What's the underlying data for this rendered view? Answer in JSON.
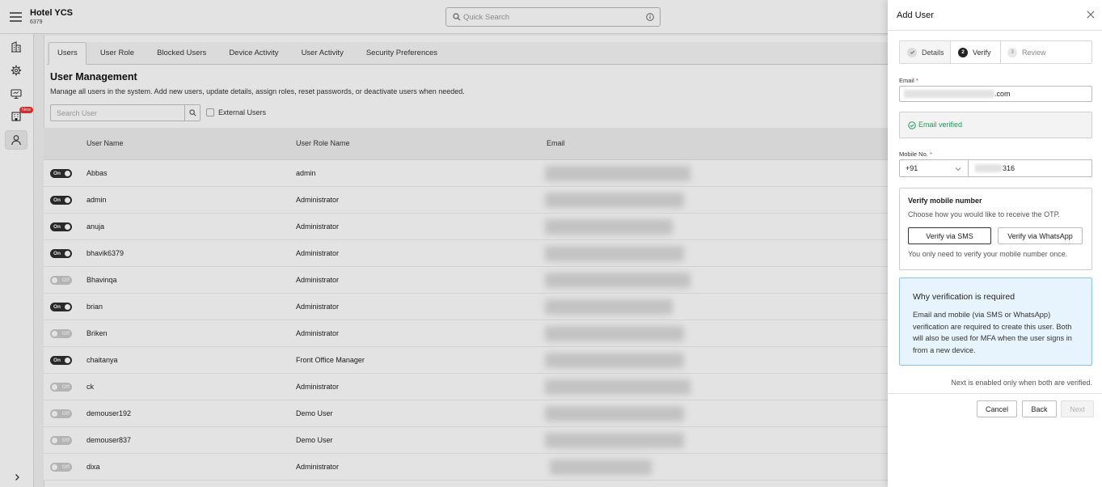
{
  "app": {
    "hotel_name": "Hotel YCS",
    "hotel_code": "6379"
  },
  "header": {
    "menu_icon": "hamburger-menu-icon",
    "search_icon": "search-icon",
    "search_placeholder": "Quick Search",
    "info_icon": "info-icon"
  },
  "sidebar": {
    "items": [
      {
        "icon": "building-icon"
      },
      {
        "icon": "gear-icon"
      },
      {
        "icon": "monitor-icon"
      },
      {
        "icon": "property-icon",
        "badge": "New"
      },
      {
        "icon": "user-icon",
        "active": true
      }
    ],
    "expand_icon": "chevron-right-icon"
  },
  "tabs": [
    {
      "label": "Users",
      "active": true
    },
    {
      "label": "User Role"
    },
    {
      "label": "Blocked Users"
    },
    {
      "label": "Device Activity"
    },
    {
      "label": "User Activity"
    },
    {
      "label": "Security Preferences"
    }
  ],
  "page": {
    "title": "User Management",
    "description": "Manage all users in the system. Add new users, update details, assign roles, reset passwords, or deactivate users when needed.",
    "search_placeholder": "Search User",
    "external_users_label": "External Users",
    "external_users_checked": false
  },
  "table": {
    "columns": {
      "name": "User Name",
      "role": "User Role Name",
      "email": "Email"
    },
    "rows": [
      {
        "status": "On",
        "enabled": true,
        "name": "Abbas",
        "role": "admin"
      },
      {
        "status": "On",
        "enabled": true,
        "name": "admin",
        "role": "Administrator"
      },
      {
        "status": "On",
        "enabled": true,
        "name": "anuja",
        "role": "Administrator"
      },
      {
        "status": "On",
        "enabled": true,
        "name": "bhavik6379",
        "role": "Administrator"
      },
      {
        "status": "Off",
        "enabled": false,
        "name": "Bhavinqa",
        "role": "Administrator"
      },
      {
        "status": "On",
        "enabled": true,
        "name": "brian",
        "role": "Administrator"
      },
      {
        "status": "Off",
        "enabled": false,
        "name": "Briken",
        "role": "Administrator"
      },
      {
        "status": "On",
        "enabled": true,
        "name": "chaitanya",
        "role": "Front Office Manager"
      },
      {
        "status": "Off",
        "enabled": false,
        "name": "ck",
        "role": "Administrator"
      },
      {
        "status": "Off",
        "enabled": false,
        "name": "demouser192",
        "role": "Demo User"
      },
      {
        "status": "Off",
        "enabled": false,
        "name": "demouser837",
        "role": "Demo User"
      },
      {
        "status": "Off",
        "enabled": false,
        "name": "dixa",
        "role": "Administrator"
      }
    ]
  },
  "drawer": {
    "title": "Add User",
    "close_icon": "close-icon",
    "steps": [
      {
        "label": "Details",
        "completed": true
      },
      {
        "number": "2",
        "label": "Verify",
        "active": true
      },
      {
        "number": "3",
        "label": "Review"
      }
    ],
    "email": {
      "label": "Email",
      "required_mark": "*",
      "value_visible": ".com",
      "verified_text": "Email verified"
    },
    "mobile": {
      "label": "Mobile No.",
      "required_mark": "*",
      "country_code": "+91",
      "number_visible": "316"
    },
    "verify_mobile": {
      "title": "Verify mobile number",
      "instructions": "Choose how you would like to receive the OTP.",
      "sms_button": "Verify via SMS",
      "whatsapp_button": "Verify via WhatsApp",
      "note": "You only need to verify your mobile number once."
    },
    "info": {
      "title": "Why verification is required",
      "body": "Email and mobile (via SMS or WhatsApp) verification are required to create this user. Both will also be used for MFA when the user signs in from a new device."
    },
    "helper_text": "Next is enabled only when both are verified.",
    "buttons": {
      "cancel": "Cancel",
      "back": "Back",
      "next": "Next",
      "next_disabled": true
    }
  },
  "colors": {
    "toggle_on": "#2f2f2f",
    "toggle_off": "#cbcbcb",
    "verified_green": "#1e9e5a",
    "info_bg": "#e8f4fd",
    "info_border": "#8ec3e8",
    "required_red": "#e53935"
  }
}
